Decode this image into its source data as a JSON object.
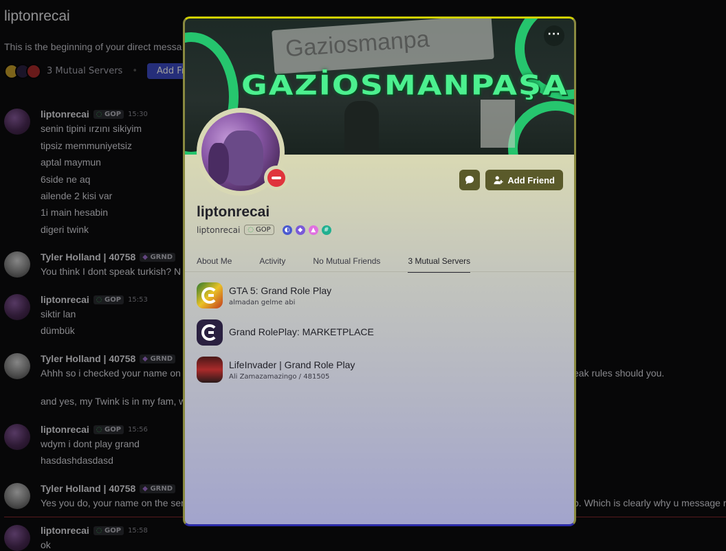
{
  "background_chat": {
    "dm_title": "liptonrecai",
    "dm_begin": "This is the beginning of your direct messa",
    "mutual_servers": "3 Mutual Servers",
    "add_friend": "Add Frie",
    "messages": [
      {
        "author": "liptonrecai",
        "tag": "GOP",
        "time": "15:30",
        "lines": [
          "senin tipini ırzını sikiyim",
          "tipsiz memmuniyetsiz",
          "aptal maymun",
          "6side ne aq",
          "ailende 2 kisi var",
          "1i main hesabin",
          "digeri twink"
        ]
      },
      {
        "author": "Tyler  Holland |  40758",
        "tag": "GRND",
        "time": "",
        "lines": [
          "You think I dont speak turkish? N"
        ]
      },
      {
        "author": "liptonrecai",
        "tag": "GOP",
        "time": "15:53",
        "lines": [
          "siktir lan",
          "dümbük"
        ]
      },
      {
        "author": "Tyler  Holland |  40758",
        "tag": "GRND",
        "time": "",
        "lines": [
          "Ahhh so i checked your name on",
          "",
          "and yes, my Twink is in my fam, w"
        ],
        "right_text": "eak rules should you."
      },
      {
        "author": "liptonrecai",
        "tag": "GOP",
        "time": "15:56",
        "lines": [
          "wdym i dont play grand",
          "hasdashdasdasd"
        ]
      },
      {
        "author": "Tyler  Holland |  40758",
        "tag": "GRND",
        "time": "",
        "lines": [
          "Yes you do, your name on the ser"
        ],
        "right_text": "p. Which is clearly why u message r"
      },
      {
        "author": "liptonrecai",
        "tag": "GOP",
        "time": "15:58",
        "lines": [
          "ok"
        ]
      }
    ]
  },
  "profile": {
    "banner_sign_text": "Gaziosmanpa",
    "banner_title": "GAZİOSMANPAŞA",
    "more_label": "···",
    "display_name": "liptonrecai",
    "username": "liptonrecai",
    "guild_tag": "GOP",
    "add_friend_label": "Add Friend",
    "badges": [
      {
        "icon": "nitro-icon",
        "color": "#4a5ad0",
        "glyph": "◐"
      },
      {
        "icon": "hypesquad-icon",
        "color": "#7a5ad8",
        "glyph": "◆"
      },
      {
        "icon": "boost-icon",
        "color": "#e070e0",
        "glyph": "▲"
      },
      {
        "icon": "quest-icon",
        "color": "#20b090",
        "glyph": "#"
      }
    ],
    "tabs": [
      "About Me",
      "Activity",
      "No Mutual Friends",
      "3 Mutual Servers"
    ],
    "selected_tab": "3 Mutual Servers",
    "servers": [
      {
        "name": "GTA 5: Grand Role Play",
        "sub": "almadan gelme abi"
      },
      {
        "name": "Grand RolePlay: MARKETPLACE",
        "sub": ""
      },
      {
        "name": "LifeInvader | Grand Role Play",
        "sub": "Ali Zamazamazingo / 481505"
      }
    ]
  }
}
